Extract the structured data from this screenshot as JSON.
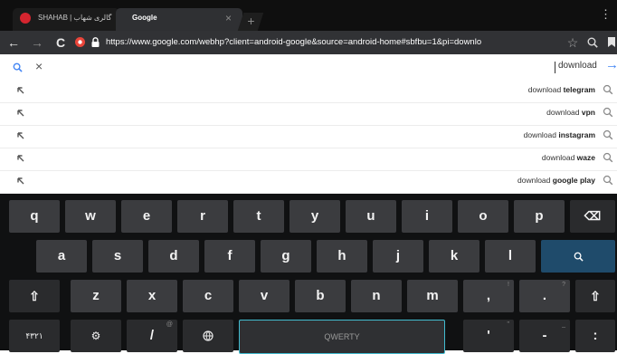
{
  "tabs": [
    {
      "title": "SHAHAB | گالری شهاب",
      "close": "×"
    },
    {
      "title": "Google",
      "close": "×"
    }
  ],
  "new_tab": "+",
  "overflow_top": "⋮",
  "toolbar": {
    "back": "←",
    "forward": "→",
    "reload": "C",
    "url": "https://www.google.com/webhp?client=android-google&source=android-home#sbfbu=1&pi=downlo",
    "star": "☆",
    "find_icon": "search-icon",
    "bookmarks_icon": "bookmark-icon"
  },
  "omnibox": {
    "clear": "×",
    "query": "download",
    "go": "→"
  },
  "suggestions": [
    {
      "prefix": "download ",
      "bold": "telegram"
    },
    {
      "prefix": "download ",
      "bold": "vpn"
    },
    {
      "prefix": "download ",
      "bold": "instagram"
    },
    {
      "prefix": "download ",
      "bold": "waze"
    },
    {
      "prefix": "download ",
      "bold": "google play"
    }
  ],
  "keyboard": {
    "row1": [
      "q",
      "w",
      "e",
      "r",
      "t",
      "y",
      "u",
      "i",
      "o",
      "p"
    ],
    "row2": [
      "a",
      "s",
      "d",
      "f",
      "g",
      "h",
      "j",
      "k",
      "l"
    ],
    "row3": [
      "z",
      "x",
      "c",
      "v",
      "b",
      "n",
      "m",
      ",",
      "."
    ],
    "row3_hints": [
      "",
      "",
      "",
      "",
      "",
      "",
      "",
      "!",
      "?"
    ],
    "shift": "⇧",
    "backspace": "⌫",
    "search": "🔍",
    "symbols": "۴۳۲۱",
    "settings": "⚙",
    "slash": "/",
    "slash_hint": "@",
    "space": "QWERTY",
    "apostrophe": "'",
    "apostrophe_hint": "\"",
    "dash": "-",
    "dash_hint": "_",
    "colon": ":",
    "lang": "🌐"
  },
  "colors": {
    "accent": "#42bcd0",
    "search_key": "#1f4b6b",
    "link_blue": "#4285f4"
  }
}
